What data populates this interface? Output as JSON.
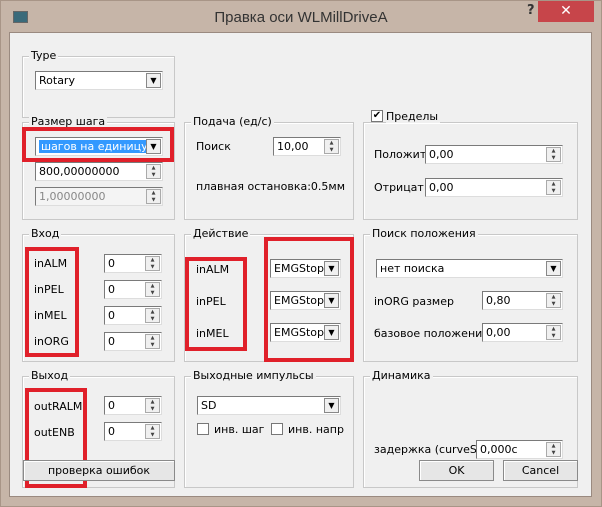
{
  "window": {
    "title": "Правка оси WLMillDriveA",
    "help": "?",
    "close": "✕"
  },
  "type": {
    "label": "Type",
    "value": "Rotary"
  },
  "step": {
    "label": "Размер шага",
    "mode": "шагов на единицу",
    "value1": "800,00000000",
    "value2": "1,00000000"
  },
  "feed": {
    "label": "Подача (ед/с)",
    "search_label": "Поиск",
    "search_value": "10,00",
    "smooth_stop": "плавная остановка:0.5мм"
  },
  "limits": {
    "label": "Пределы",
    "checked": true,
    "pos_label": "Положит",
    "pos_value": "0,00",
    "neg_label": "Отрицат",
    "neg_value": "0,00"
  },
  "input": {
    "label": "Вход",
    "items": [
      {
        "name": "inALM",
        "value": "0"
      },
      {
        "name": "inPEL",
        "value": "0"
      },
      {
        "name": "inMEL",
        "value": "0"
      },
      {
        "name": "inORG",
        "value": "0"
      }
    ]
  },
  "action": {
    "label": "Действие",
    "items": [
      {
        "name": "inALM",
        "value": "EMGStop"
      },
      {
        "name": "inPEL",
        "value": "EMGStop"
      },
      {
        "name": "inMEL",
        "value": "EMGStop"
      }
    ]
  },
  "homing": {
    "label": "Поиск положения",
    "mode": "нет поиска",
    "org_size_label": "inORG размер",
    "org_size_value": "0,80",
    "base_label": "базовое положение",
    "base_value": "0,00"
  },
  "output": {
    "label": "Выход",
    "items": [
      {
        "name": "outRALM",
        "value": "0"
      },
      {
        "name": "outENB",
        "value": "0"
      }
    ]
  },
  "pulses": {
    "label": "Выходные импульсы",
    "mode": "SD",
    "inv_step": "инв. шаг",
    "inv_dir": "инв. напр"
  },
  "dynamics": {
    "label": "Динамика",
    "delay_label": "задержка (curveS)",
    "delay_value": "0,000c"
  },
  "buttons": {
    "check": "проверка ошибок",
    "ok": "OK",
    "cancel": "Cancel"
  },
  "colors": {
    "highlight": "#e0202a",
    "selection": "#3399ff",
    "close": "#c7454a"
  }
}
